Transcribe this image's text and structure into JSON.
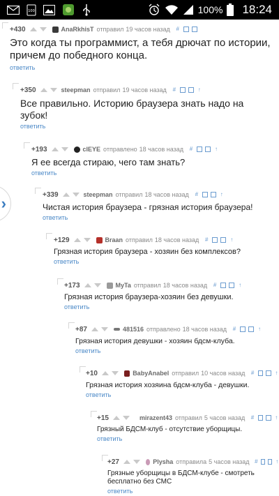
{
  "status_bar": {
    "icons": [
      "mail-icon",
      "storage-100-icon",
      "gallery-icon",
      "game-icon",
      "usb-icon",
      "alarm-icon",
      "wifi-icon",
      "signal-icon",
      "battery-icon"
    ],
    "battery_text": "100%",
    "time": "18:24",
    "storage_badge": "100"
  },
  "colors": {
    "link": "#4a88c7",
    "meta": "#8a8a8a",
    "arrow": "#c9c9c9",
    "action_icons": "#6a9bcf"
  },
  "comments": [
    {
      "rating": "+430",
      "author": "AnaRkhisT",
      "sent": "отправил",
      "time": "19 часов назад",
      "text": "Это когда ты программист, а тебя дрючат по истории, причем до победного конца.",
      "reply": "ответить"
    },
    {
      "rating": "+350",
      "author": "steepman",
      "sent": "отправил",
      "time": "19 часов назад",
      "text": "Все правильно. Историю браузера знать надо на зубок!",
      "reply": "ответить"
    },
    {
      "rating": "+193",
      "author": "clEYE",
      "sent": "отправлено",
      "time": "18 часов назад",
      "text": "Я ее всегда стираю, чего там знать?",
      "reply": "ответить"
    },
    {
      "rating": "+339",
      "author": "steepman",
      "sent": "отправил",
      "time": "18 часов назад",
      "text": "Чистая история браузера - грязная история браузера!",
      "reply": "ответить"
    },
    {
      "rating": "+129",
      "author": "Braan",
      "sent": "отправил",
      "time": "18 часов назад",
      "text": "Грязная история браузера - хозяин без комплексов?",
      "reply": "ответить"
    },
    {
      "rating": "+173",
      "author": "MyTa",
      "sent": "отправил",
      "time": "18 часов назад",
      "text": "Грязная история браузера-хозяин без девушки.",
      "reply": "ответить"
    },
    {
      "rating": "+87",
      "author": "481516",
      "sent": "отправлено",
      "time": "18 часов назад",
      "text": "Грязная история девушки - хозяин бдсм-клуба.",
      "reply": "ответить"
    },
    {
      "rating": "+10",
      "author": "BabyAnabel",
      "sent": "отправил",
      "time": "10 часов назад",
      "text": "Грязная история хозяина бдсм-клуба - девушки.",
      "reply": "ответить"
    },
    {
      "rating": "+15",
      "author": "mirazent43",
      "sent": "отправил",
      "time": "5 часов назад",
      "text": "Грязный БДСМ-клуб - отсутствие уборщицы.",
      "reply": "ответить"
    },
    {
      "rating": "+27",
      "author": "Plysha",
      "sent": "отправила",
      "time": "5 часов назад",
      "text": "Грязные уборщицы в БДСМ-клубе - смотреть бесплатно без СМС",
      "reply": "ответить"
    }
  ],
  "side_tab": {
    "icon": "chevron-right-icon"
  }
}
